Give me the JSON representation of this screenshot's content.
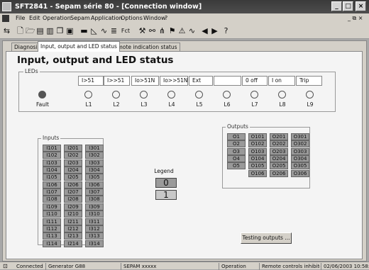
{
  "titlebar": {
    "title": "SFT2841 - Sepam série 80 - [Connection window]",
    "btn_min": "_",
    "btn_max": "□",
    "btn_close": "×"
  },
  "menubar": {
    "items": [
      "File",
      "Edit",
      "Operation",
      "Sepam",
      "Application",
      "Options",
      "Window",
      "?"
    ],
    "mdi_controls": "_ ⧉ ×"
  },
  "toolbar": {
    "icons": [
      "connect-icon",
      "new-icon",
      "open-icon",
      "save-icon",
      "print-icon",
      "copy-icon",
      "paste-icon",
      "monitor-icon",
      "chart-icon",
      "graph-icon",
      "list-icon",
      "fct-icon",
      "tool-icon",
      "branch-icon",
      "tree-icon",
      "flag-icon",
      "warning-icon",
      "waveform-icon",
      "arrow-left-icon",
      "arrow-right-icon",
      "help-icon"
    ],
    "fct_label": "Fct"
  },
  "tabs": [
    "Diagnosis",
    "Input, output and LED status",
    "Remote indication status"
  ],
  "page": {
    "title": "Input, output and LED status"
  },
  "leds": {
    "group_label": "LEDs",
    "headers": [
      "I>51",
      "I>>51",
      "Io>51N",
      "Io>>51N",
      "Ext",
      "",
      "0 off",
      "I on",
      "Trip"
    ],
    "items": [
      {
        "label": "Fault",
        "state": "on"
      },
      {
        "label": "L1",
        "state": "off"
      },
      {
        "label": "L2",
        "state": "off"
      },
      {
        "label": "L3",
        "state": "off"
      },
      {
        "label": "L4",
        "state": "off"
      },
      {
        "label": "L5",
        "state": "off"
      },
      {
        "label": "L6",
        "state": "off"
      },
      {
        "label": "L7",
        "state": "off"
      },
      {
        "label": "L8",
        "state": "off"
      },
      {
        "label": "L9",
        "state": "off"
      }
    ]
  },
  "inputs": {
    "group_label": "Inputs",
    "columns": [
      [
        "I101",
        "I102",
        "I103",
        "I104",
        "I105",
        "I106",
        "I107",
        "I108",
        "I109",
        "I110",
        "I111",
        "I112",
        "I113",
        "I114"
      ],
      [
        "I201",
        "I202",
        "I203",
        "I204",
        "I205",
        "I206",
        "I207",
        "I208",
        "I209",
        "I210",
        "I211",
        "I212",
        "I213",
        "I214"
      ],
      [
        "I301",
        "I302",
        "I303",
        "I304",
        "I305",
        "I306",
        "I307",
        "I308",
        "I309",
        "I310",
        "I311",
        "I312",
        "I313",
        "I314"
      ]
    ]
  },
  "legend": {
    "label": "Legend",
    "zero": "0",
    "one": "1"
  },
  "outputs": {
    "group_label": "Outputs",
    "columns": [
      [
        "O1",
        "O2",
        "O3",
        "O4",
        "O5"
      ],
      [
        "O101",
        "O102",
        "O103",
        "O104",
        "O105",
        "O106"
      ],
      [
        "O201",
        "O202",
        "O203",
        "O204",
        "O205",
        "O206"
      ],
      [
        "O301",
        "O302",
        "O303",
        "O304",
        "O305",
        "O306"
      ]
    ],
    "test_button": "Testing outputs ..."
  },
  "statusbar": {
    "connected": "Connected",
    "generator": "Generator G88",
    "sepam": "SEPAM xxxxx",
    "mode": "Operation",
    "remote": "Remote controls inhibited",
    "datetime": "02/06/2003 10:58:00"
  },
  "colors": {
    "titlebar": "#3a3a3a",
    "cell": "#999999",
    "led_on": "#555555",
    "legend_zero": "#9a9a9a",
    "legend_one": "#c8c8c8"
  }
}
